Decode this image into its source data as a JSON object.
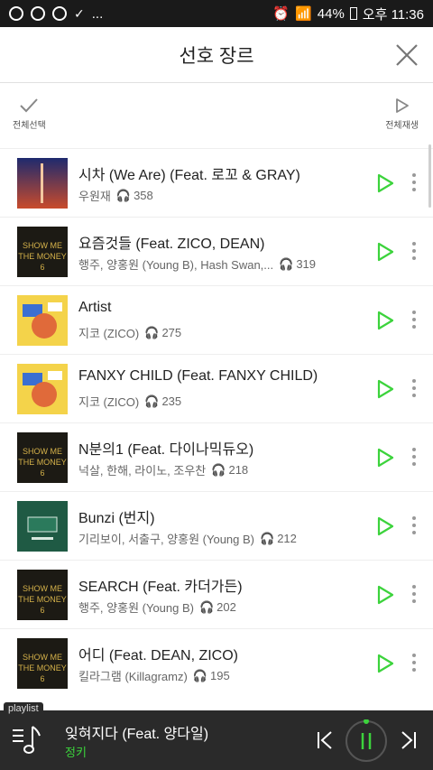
{
  "status_bar": {
    "battery": "44%",
    "time": "오후 11:36",
    "more": "..."
  },
  "header": {
    "title": "선호 장르"
  },
  "toolbar": {
    "select_all": "전체선택",
    "play_all": "전체재생"
  },
  "songs": [
    {
      "title": "시차 (We Are) (Feat. 로꼬 & GRAY)",
      "artist": "우원재",
      "plays": "358"
    },
    {
      "title": "요즘것들 (Feat. ZICO, DEAN)",
      "artist": "행주, 양홍원 (Young B), Hash Swan,...",
      "plays": "319"
    },
    {
      "title": "Artist",
      "artist": "지코 (ZICO)",
      "plays": "275"
    },
    {
      "title": "FANXY CHILD (Feat. FANXY CHILD)",
      "artist": "지코 (ZICO)",
      "plays": "235"
    },
    {
      "title": "N분의1 (Feat. 다이나믹듀오)",
      "artist": "넉살, 한해, 라이노, 조우찬",
      "plays": "218"
    },
    {
      "title": "Bunzi (번지)",
      "artist": "기리보이, 서출구, 양홍원 (Young B)",
      "plays": "212"
    },
    {
      "title": "SEARCH (Feat. 카더가든)",
      "artist": "행주, 양홍원 (Young B)",
      "plays": "202"
    },
    {
      "title": "어디 (Feat. DEAN, ZICO)",
      "artist": "킬라그램 (Killagramz)",
      "plays": "195"
    }
  ],
  "player": {
    "playlist_label": "playlist",
    "now_playing": "잊혀지다 (Feat. 양다일)",
    "artist": "정키"
  },
  "colors": {
    "accent_green": "#3cd33c",
    "player_bg": "#2a2a2a"
  }
}
